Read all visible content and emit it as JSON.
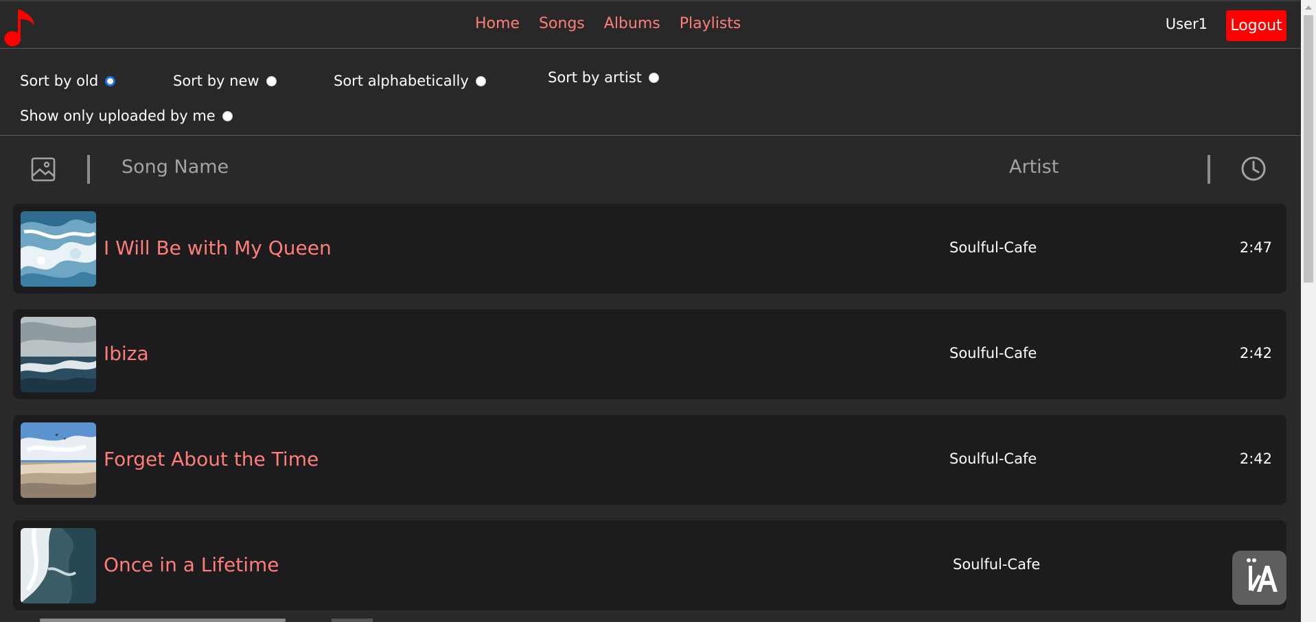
{
  "nav": {
    "links": [
      "Home",
      "Songs",
      "Albums",
      "Playlists"
    ],
    "username": "User1",
    "logout_label": "Logout"
  },
  "sort": {
    "options": [
      {
        "label": "Sort by old",
        "checked": true
      },
      {
        "label": "Sort by new",
        "checked": false
      },
      {
        "label": "Sort alphabetically",
        "checked": false
      },
      {
        "label": "Sort by artist",
        "checked": false
      },
      {
        "label": "Show only uploaded by me",
        "checked": false
      }
    ]
  },
  "table": {
    "col_song": "Song Name",
    "col_artist": "Artist",
    "rows": [
      {
        "title": "I Will Be with My Queen",
        "artist": "Soulful-Cafe",
        "duration": "2:47",
        "thumb": "ocean-waves"
      },
      {
        "title": "Ibiza",
        "artist": "Soulful-Cafe",
        "duration": "2:42",
        "thumb": "sea-horizon"
      },
      {
        "title": "Forget About the Time",
        "artist": "Soulful-Cafe",
        "duration": "2:42",
        "thumb": "beach-sky"
      },
      {
        "title": "Once in a Lifetime",
        "artist": "Soulful-Cafe",
        "duration": "",
        "thumb": "aerial-surf"
      }
    ]
  },
  "icons": {
    "logo": "music-note-icon",
    "image_column": "image-icon",
    "duration_column": "clock-icon",
    "widget": "translate-icon"
  },
  "colors": {
    "accent": "#ff7f78",
    "logout_bg": "#ff0000",
    "background": "#292929",
    "row_bg": "#1c1c1e",
    "logo": "#ff0000"
  }
}
